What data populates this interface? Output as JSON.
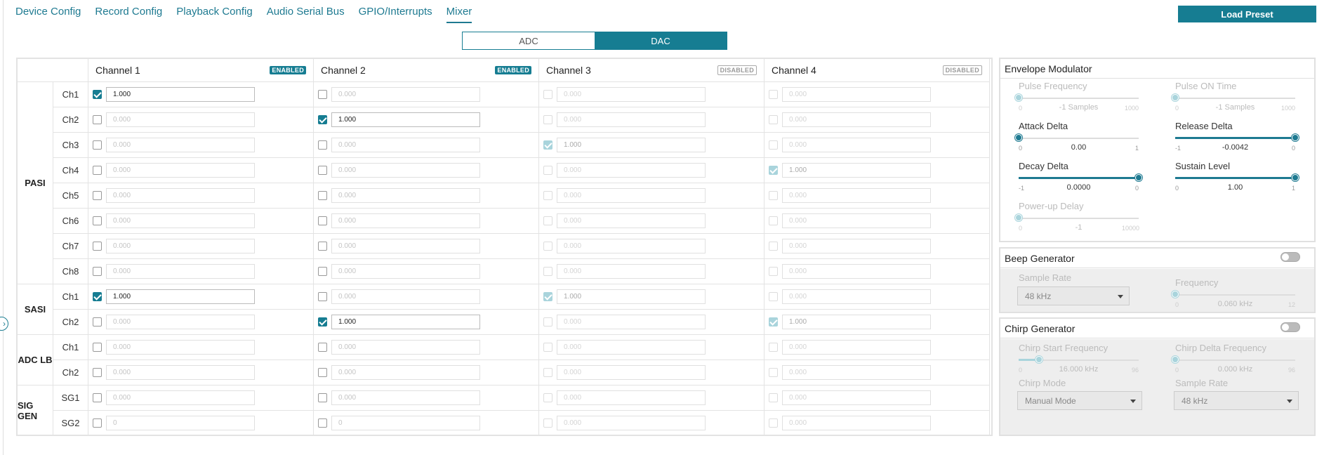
{
  "nav": {
    "tabs": [
      "Device Config",
      "Record Config",
      "Playback Config",
      "Audio Serial Bus",
      "GPIO/Interrupts",
      "Mixer"
    ],
    "active": "Mixer",
    "load_preset": "Load Preset"
  },
  "mode": {
    "adc": "ADC",
    "dac": "DAC",
    "selected": "DAC"
  },
  "mixer": {
    "channels": [
      {
        "name": "Channel 1",
        "status": "ENABLED"
      },
      {
        "name": "Channel 2",
        "status": "ENABLED"
      },
      {
        "name": "Channel 3",
        "status": "DISABLED"
      },
      {
        "name": "Channel 4",
        "status": "DISABLED"
      }
    ],
    "groups": [
      {
        "label": "PASI",
        "rows": [
          "Ch1",
          "Ch2",
          "Ch3",
          "Ch4",
          "Ch5",
          "Ch6",
          "Ch7",
          "Ch8"
        ]
      },
      {
        "label": "SASI",
        "rows": [
          "Ch1",
          "Ch2"
        ]
      },
      {
        "label": "ADC LB",
        "rows": [
          "Ch1",
          "Ch2"
        ]
      },
      {
        "label": "SIG GEN",
        "rows": [
          "SG1",
          "SG2"
        ]
      }
    ],
    "rows": [
      {
        "cells": [
          {
            "checked": true,
            "value": "1.000"
          },
          {
            "checked": false,
            "value": "0.000"
          },
          {
            "checked": false,
            "value": "0.000"
          },
          {
            "checked": false,
            "value": "0.000"
          }
        ]
      },
      {
        "cells": [
          {
            "checked": false,
            "value": "0.000"
          },
          {
            "checked": true,
            "value": "1.000"
          },
          {
            "checked": false,
            "value": "0.000"
          },
          {
            "checked": false,
            "value": "0.000"
          }
        ]
      },
      {
        "cells": [
          {
            "checked": false,
            "value": "0.000"
          },
          {
            "checked": false,
            "value": "0.000"
          },
          {
            "checked": true,
            "value": "1.000"
          },
          {
            "checked": false,
            "value": "0.000"
          }
        ]
      },
      {
        "cells": [
          {
            "checked": false,
            "value": "0.000"
          },
          {
            "checked": false,
            "value": "0.000"
          },
          {
            "checked": false,
            "value": "0.000"
          },
          {
            "checked": true,
            "value": "1.000"
          }
        ]
      },
      {
        "cells": [
          {
            "checked": false,
            "value": "0.000"
          },
          {
            "checked": false,
            "value": "0.000"
          },
          {
            "checked": false,
            "value": "0.000"
          },
          {
            "checked": false,
            "value": "0.000"
          }
        ]
      },
      {
        "cells": [
          {
            "checked": false,
            "value": "0.000"
          },
          {
            "checked": false,
            "value": "0.000"
          },
          {
            "checked": false,
            "value": "0.000"
          },
          {
            "checked": false,
            "value": "0.000"
          }
        ]
      },
      {
        "cells": [
          {
            "checked": false,
            "value": "0.000"
          },
          {
            "checked": false,
            "value": "0.000"
          },
          {
            "checked": false,
            "value": "0.000"
          },
          {
            "checked": false,
            "value": "0.000"
          }
        ]
      },
      {
        "cells": [
          {
            "checked": false,
            "value": "0.000"
          },
          {
            "checked": false,
            "value": "0.000"
          },
          {
            "checked": false,
            "value": "0.000"
          },
          {
            "checked": false,
            "value": "0.000"
          }
        ]
      },
      {
        "cells": [
          {
            "checked": true,
            "value": "1.000"
          },
          {
            "checked": false,
            "value": "0.000"
          },
          {
            "checked": true,
            "value": "1.000"
          },
          {
            "checked": false,
            "value": "0.000"
          }
        ]
      },
      {
        "cells": [
          {
            "checked": false,
            "value": "0.000"
          },
          {
            "checked": true,
            "value": "1.000"
          },
          {
            "checked": false,
            "value": "0.000"
          },
          {
            "checked": true,
            "value": "1.000"
          }
        ]
      },
      {
        "cells": [
          {
            "checked": false,
            "value": "0.000"
          },
          {
            "checked": false,
            "value": "0.000"
          },
          {
            "checked": false,
            "value": "0.000"
          },
          {
            "checked": false,
            "value": "0.000"
          }
        ]
      },
      {
        "cells": [
          {
            "checked": false,
            "value": "0.000"
          },
          {
            "checked": false,
            "value": "0.000"
          },
          {
            "checked": false,
            "value": "0.000"
          },
          {
            "checked": false,
            "value": "0.000"
          }
        ]
      },
      {
        "cells": [
          {
            "checked": false,
            "value": "0.000"
          },
          {
            "checked": false,
            "value": "0.000"
          },
          {
            "checked": false,
            "value": "0.000"
          },
          {
            "checked": false,
            "value": "0.000"
          }
        ]
      },
      {
        "cells": [
          {
            "checked": false,
            "value": "0"
          },
          {
            "checked": false,
            "value": "0"
          },
          {
            "checked": false,
            "value": "0.000"
          },
          {
            "checked": false,
            "value": "0.000"
          }
        ]
      }
    ]
  },
  "envelope": {
    "title": "Envelope Modulator",
    "sliders": [
      {
        "label": "Pulse Frequency",
        "min": "0",
        "max": "1000",
        "value": "-1 Samples",
        "fraction": 0,
        "enabled": false
      },
      {
        "label": "Pulse ON Time",
        "min": "0",
        "max": "1000",
        "value": "-1 Samples",
        "fraction": 0,
        "enabled": false
      },
      {
        "label": "Attack Delta",
        "min": "0",
        "max": "1",
        "value": "0.00",
        "fraction": 0,
        "enabled": true
      },
      {
        "label": "Release Delta",
        "min": "-1",
        "max": "0",
        "value": "-0.0042",
        "fraction": 1,
        "enabled": true
      },
      {
        "label": "Decay Delta",
        "min": "-1",
        "max": "0",
        "value": "0.0000",
        "fraction": 1,
        "enabled": true
      },
      {
        "label": "Sustain Level",
        "min": "0",
        "max": "1",
        "value": "1.00",
        "fraction": 1,
        "enabled": true
      },
      {
        "label": "Power-up Delay",
        "min": "0",
        "max": "10000",
        "value": "-1",
        "fraction": 0,
        "enabled": false
      }
    ]
  },
  "beep": {
    "title": "Beep Generator",
    "sample_rate_label": "Sample Rate",
    "sample_rate": "48 kHz",
    "frequency": {
      "label": "Frequency",
      "min": "0",
      "max": "12",
      "value": "0.060 kHz",
      "fraction": 0
    }
  },
  "chirp": {
    "title": "Chirp Generator",
    "start": {
      "label": "Chirp Start Frequency",
      "min": "0",
      "max": "96",
      "value": "16.000 kHz",
      "fraction": 0.167
    },
    "delta": {
      "label": "Chirp Delta Frequency",
      "min": "0",
      "max": "96",
      "value": "0.000 kHz",
      "fraction": 0
    },
    "mode_label": "Chirp Mode",
    "mode": "Manual Mode",
    "sample_rate_label": "Sample Rate",
    "sample_rate": "48 kHz"
  }
}
